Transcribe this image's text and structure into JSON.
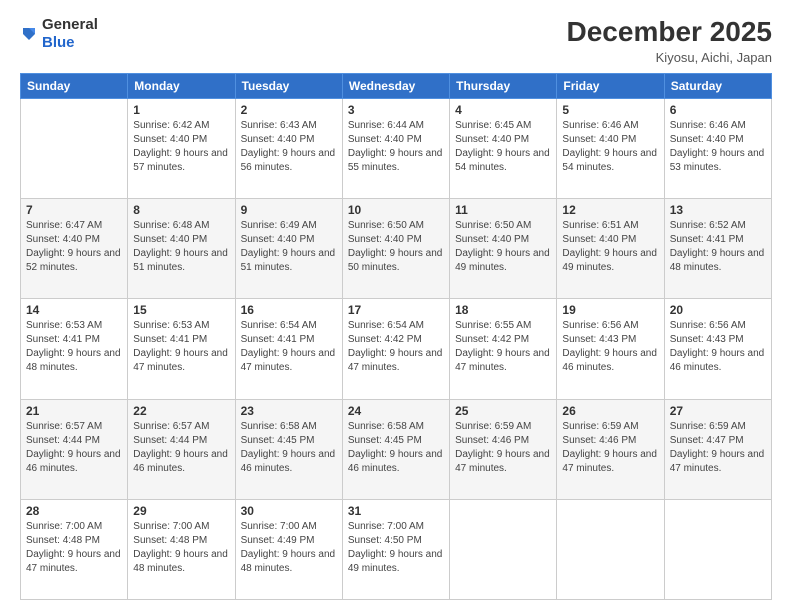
{
  "logo": {
    "general": "General",
    "blue": "Blue"
  },
  "header": {
    "month": "December 2025",
    "location": "Kiyosu, Aichi, Japan"
  },
  "days_of_week": [
    "Sunday",
    "Monday",
    "Tuesday",
    "Wednesday",
    "Thursday",
    "Friday",
    "Saturday"
  ],
  "weeks": [
    [
      {
        "day": "",
        "sunrise": "",
        "sunset": "",
        "daylight": ""
      },
      {
        "day": "1",
        "sunrise": "Sunrise: 6:42 AM",
        "sunset": "Sunset: 4:40 PM",
        "daylight": "Daylight: 9 hours and 57 minutes."
      },
      {
        "day": "2",
        "sunrise": "Sunrise: 6:43 AM",
        "sunset": "Sunset: 4:40 PM",
        "daylight": "Daylight: 9 hours and 56 minutes."
      },
      {
        "day": "3",
        "sunrise": "Sunrise: 6:44 AM",
        "sunset": "Sunset: 4:40 PM",
        "daylight": "Daylight: 9 hours and 55 minutes."
      },
      {
        "day": "4",
        "sunrise": "Sunrise: 6:45 AM",
        "sunset": "Sunset: 4:40 PM",
        "daylight": "Daylight: 9 hours and 54 minutes."
      },
      {
        "day": "5",
        "sunrise": "Sunrise: 6:46 AM",
        "sunset": "Sunset: 4:40 PM",
        "daylight": "Daylight: 9 hours and 54 minutes."
      },
      {
        "day": "6",
        "sunrise": "Sunrise: 6:46 AM",
        "sunset": "Sunset: 4:40 PM",
        "daylight": "Daylight: 9 hours and 53 minutes."
      }
    ],
    [
      {
        "day": "7",
        "sunrise": "Sunrise: 6:47 AM",
        "sunset": "Sunset: 4:40 PM",
        "daylight": "Daylight: 9 hours and 52 minutes."
      },
      {
        "day": "8",
        "sunrise": "Sunrise: 6:48 AM",
        "sunset": "Sunset: 4:40 PM",
        "daylight": "Daylight: 9 hours and 51 minutes."
      },
      {
        "day": "9",
        "sunrise": "Sunrise: 6:49 AM",
        "sunset": "Sunset: 4:40 PM",
        "daylight": "Daylight: 9 hours and 51 minutes."
      },
      {
        "day": "10",
        "sunrise": "Sunrise: 6:50 AM",
        "sunset": "Sunset: 4:40 PM",
        "daylight": "Daylight: 9 hours and 50 minutes."
      },
      {
        "day": "11",
        "sunrise": "Sunrise: 6:50 AM",
        "sunset": "Sunset: 4:40 PM",
        "daylight": "Daylight: 9 hours and 49 minutes."
      },
      {
        "day": "12",
        "sunrise": "Sunrise: 6:51 AM",
        "sunset": "Sunset: 4:40 PM",
        "daylight": "Daylight: 9 hours and 49 minutes."
      },
      {
        "day": "13",
        "sunrise": "Sunrise: 6:52 AM",
        "sunset": "Sunset: 4:41 PM",
        "daylight": "Daylight: 9 hours and 48 minutes."
      }
    ],
    [
      {
        "day": "14",
        "sunrise": "Sunrise: 6:53 AM",
        "sunset": "Sunset: 4:41 PM",
        "daylight": "Daylight: 9 hours and 48 minutes."
      },
      {
        "day": "15",
        "sunrise": "Sunrise: 6:53 AM",
        "sunset": "Sunset: 4:41 PM",
        "daylight": "Daylight: 9 hours and 47 minutes."
      },
      {
        "day": "16",
        "sunrise": "Sunrise: 6:54 AM",
        "sunset": "Sunset: 4:41 PM",
        "daylight": "Daylight: 9 hours and 47 minutes."
      },
      {
        "day": "17",
        "sunrise": "Sunrise: 6:54 AM",
        "sunset": "Sunset: 4:42 PM",
        "daylight": "Daylight: 9 hours and 47 minutes."
      },
      {
        "day": "18",
        "sunrise": "Sunrise: 6:55 AM",
        "sunset": "Sunset: 4:42 PM",
        "daylight": "Daylight: 9 hours and 47 minutes."
      },
      {
        "day": "19",
        "sunrise": "Sunrise: 6:56 AM",
        "sunset": "Sunset: 4:43 PM",
        "daylight": "Daylight: 9 hours and 46 minutes."
      },
      {
        "day": "20",
        "sunrise": "Sunrise: 6:56 AM",
        "sunset": "Sunset: 4:43 PM",
        "daylight": "Daylight: 9 hours and 46 minutes."
      }
    ],
    [
      {
        "day": "21",
        "sunrise": "Sunrise: 6:57 AM",
        "sunset": "Sunset: 4:44 PM",
        "daylight": "Daylight: 9 hours and 46 minutes."
      },
      {
        "day": "22",
        "sunrise": "Sunrise: 6:57 AM",
        "sunset": "Sunset: 4:44 PM",
        "daylight": "Daylight: 9 hours and 46 minutes."
      },
      {
        "day": "23",
        "sunrise": "Sunrise: 6:58 AM",
        "sunset": "Sunset: 4:45 PM",
        "daylight": "Daylight: 9 hours and 46 minutes."
      },
      {
        "day": "24",
        "sunrise": "Sunrise: 6:58 AM",
        "sunset": "Sunset: 4:45 PM",
        "daylight": "Daylight: 9 hours and 46 minutes."
      },
      {
        "day": "25",
        "sunrise": "Sunrise: 6:59 AM",
        "sunset": "Sunset: 4:46 PM",
        "daylight": "Daylight: 9 hours and 47 minutes."
      },
      {
        "day": "26",
        "sunrise": "Sunrise: 6:59 AM",
        "sunset": "Sunset: 4:46 PM",
        "daylight": "Daylight: 9 hours and 47 minutes."
      },
      {
        "day": "27",
        "sunrise": "Sunrise: 6:59 AM",
        "sunset": "Sunset: 4:47 PM",
        "daylight": "Daylight: 9 hours and 47 minutes."
      }
    ],
    [
      {
        "day": "28",
        "sunrise": "Sunrise: 7:00 AM",
        "sunset": "Sunset: 4:48 PM",
        "daylight": "Daylight: 9 hours and 47 minutes."
      },
      {
        "day": "29",
        "sunrise": "Sunrise: 7:00 AM",
        "sunset": "Sunset: 4:48 PM",
        "daylight": "Daylight: 9 hours and 48 minutes."
      },
      {
        "day": "30",
        "sunrise": "Sunrise: 7:00 AM",
        "sunset": "Sunset: 4:49 PM",
        "daylight": "Daylight: 9 hours and 48 minutes."
      },
      {
        "day": "31",
        "sunrise": "Sunrise: 7:00 AM",
        "sunset": "Sunset: 4:50 PM",
        "daylight": "Daylight: 9 hours and 49 minutes."
      },
      {
        "day": "",
        "sunrise": "",
        "sunset": "",
        "daylight": ""
      },
      {
        "day": "",
        "sunrise": "",
        "sunset": "",
        "daylight": ""
      },
      {
        "day": "",
        "sunrise": "",
        "sunset": "",
        "daylight": ""
      }
    ]
  ]
}
